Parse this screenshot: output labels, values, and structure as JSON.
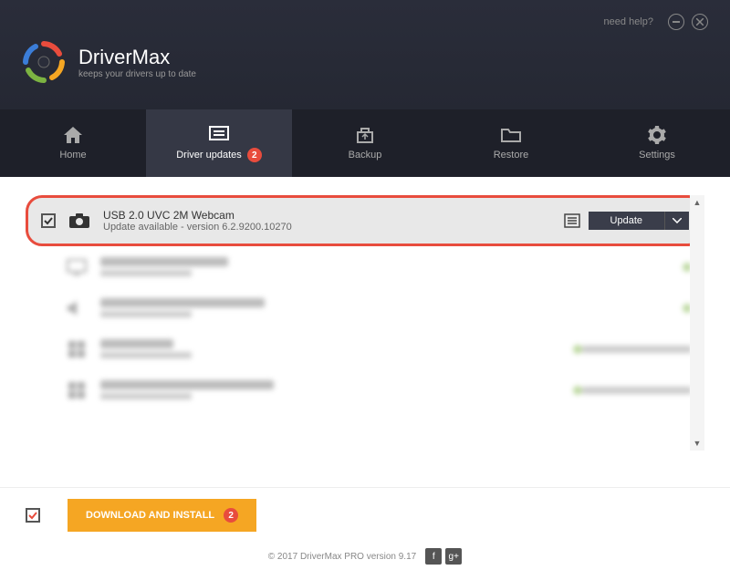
{
  "header": {
    "help_link": "need help?",
    "brand_title": "DriverMax",
    "brand_subtitle": "keeps your drivers up to date"
  },
  "nav": {
    "items": [
      {
        "label": "Home"
      },
      {
        "label": "Driver updates",
        "badge": "2"
      },
      {
        "label": "Backup"
      },
      {
        "label": "Restore"
      },
      {
        "label": "Settings"
      }
    ]
  },
  "drivers": {
    "featured": {
      "name": "USB 2.0 UVC 2M Webcam",
      "status": "Update available - version 6.2.9200.10270",
      "action": "Update"
    },
    "blurred": [
      {
        "name": "NVIDIA GeForce 210"
      },
      {
        "name": "High Definition Audio Device"
      },
      {
        "name": "Intel Device"
      },
      {
        "name": "Intel(R) 82801 PCI Bridge - 244E"
      }
    ]
  },
  "footer": {
    "download_btn": "DOWNLOAD AND INSTALL",
    "download_badge": "2",
    "copyright": "© 2017 DriverMax PRO version 9.17"
  }
}
